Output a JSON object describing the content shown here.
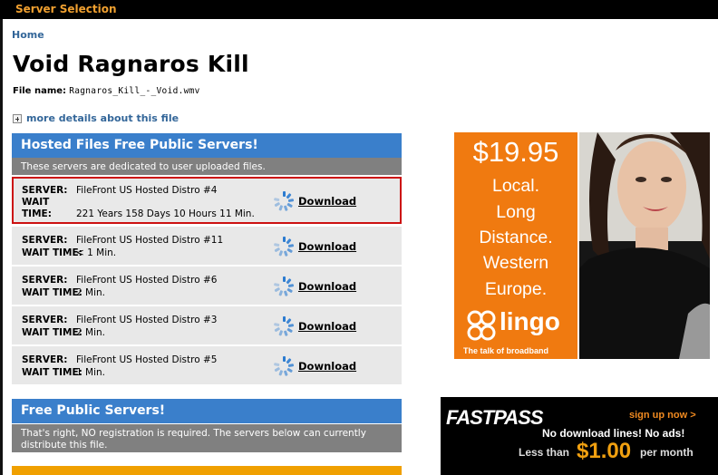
{
  "topbar": {
    "title": "Server Selection"
  },
  "breadcrumb": {
    "home": "Home"
  },
  "page": {
    "title": "Void Ragnaros Kill",
    "file_name_label": "File name:",
    "file_name": "Ragnaros_Kill_-_Void.wmv",
    "more_details": "more details about this file"
  },
  "hosted": {
    "title": "Hosted Files Free Public Servers!",
    "subtitle": "These servers are dedicated to user uploaded files.",
    "server_label": "SERVER:",
    "wait_label": "WAIT TIME:",
    "download_label": "Download",
    "servers": [
      {
        "name": "FileFront US Hosted Distro #4",
        "wait": "221 Years 158 Days 10 Hours 11 Min."
      },
      {
        "name": "FileFront US Hosted Distro #11",
        "wait": "< 1 Min."
      },
      {
        "name": "FileFront US Hosted Distro #6",
        "wait": "2 Min."
      },
      {
        "name": "FileFront US Hosted Distro #3",
        "wait": "2 Min."
      },
      {
        "name": "FileFront US Hosted Distro #5",
        "wait": "1 Min."
      }
    ]
  },
  "free": {
    "title": "Free Public Servers!",
    "subtitle": "That's right, NO registration is required. The servers below can currently distribute this file."
  },
  "ads": {
    "lingo": {
      "price": "$19.95",
      "lines": [
        "Local.",
        "Long",
        "Distance.",
        "Western",
        "Europe."
      ],
      "brand": "lingo",
      "tagline": "The talk of broadband"
    },
    "fastpass": {
      "logo": "FASTPASS",
      "signup": "sign up now >",
      "line1": "No download lines!  No ads!",
      "less_than": "Less than",
      "price": "$1.00",
      "per_month": "per month"
    }
  },
  "colors": {
    "accent_blue": "#3a7fcb",
    "highlight_red": "#cc1111",
    "top_title_orange": "#f0a030",
    "lingo_orange": "#f07a10"
  }
}
